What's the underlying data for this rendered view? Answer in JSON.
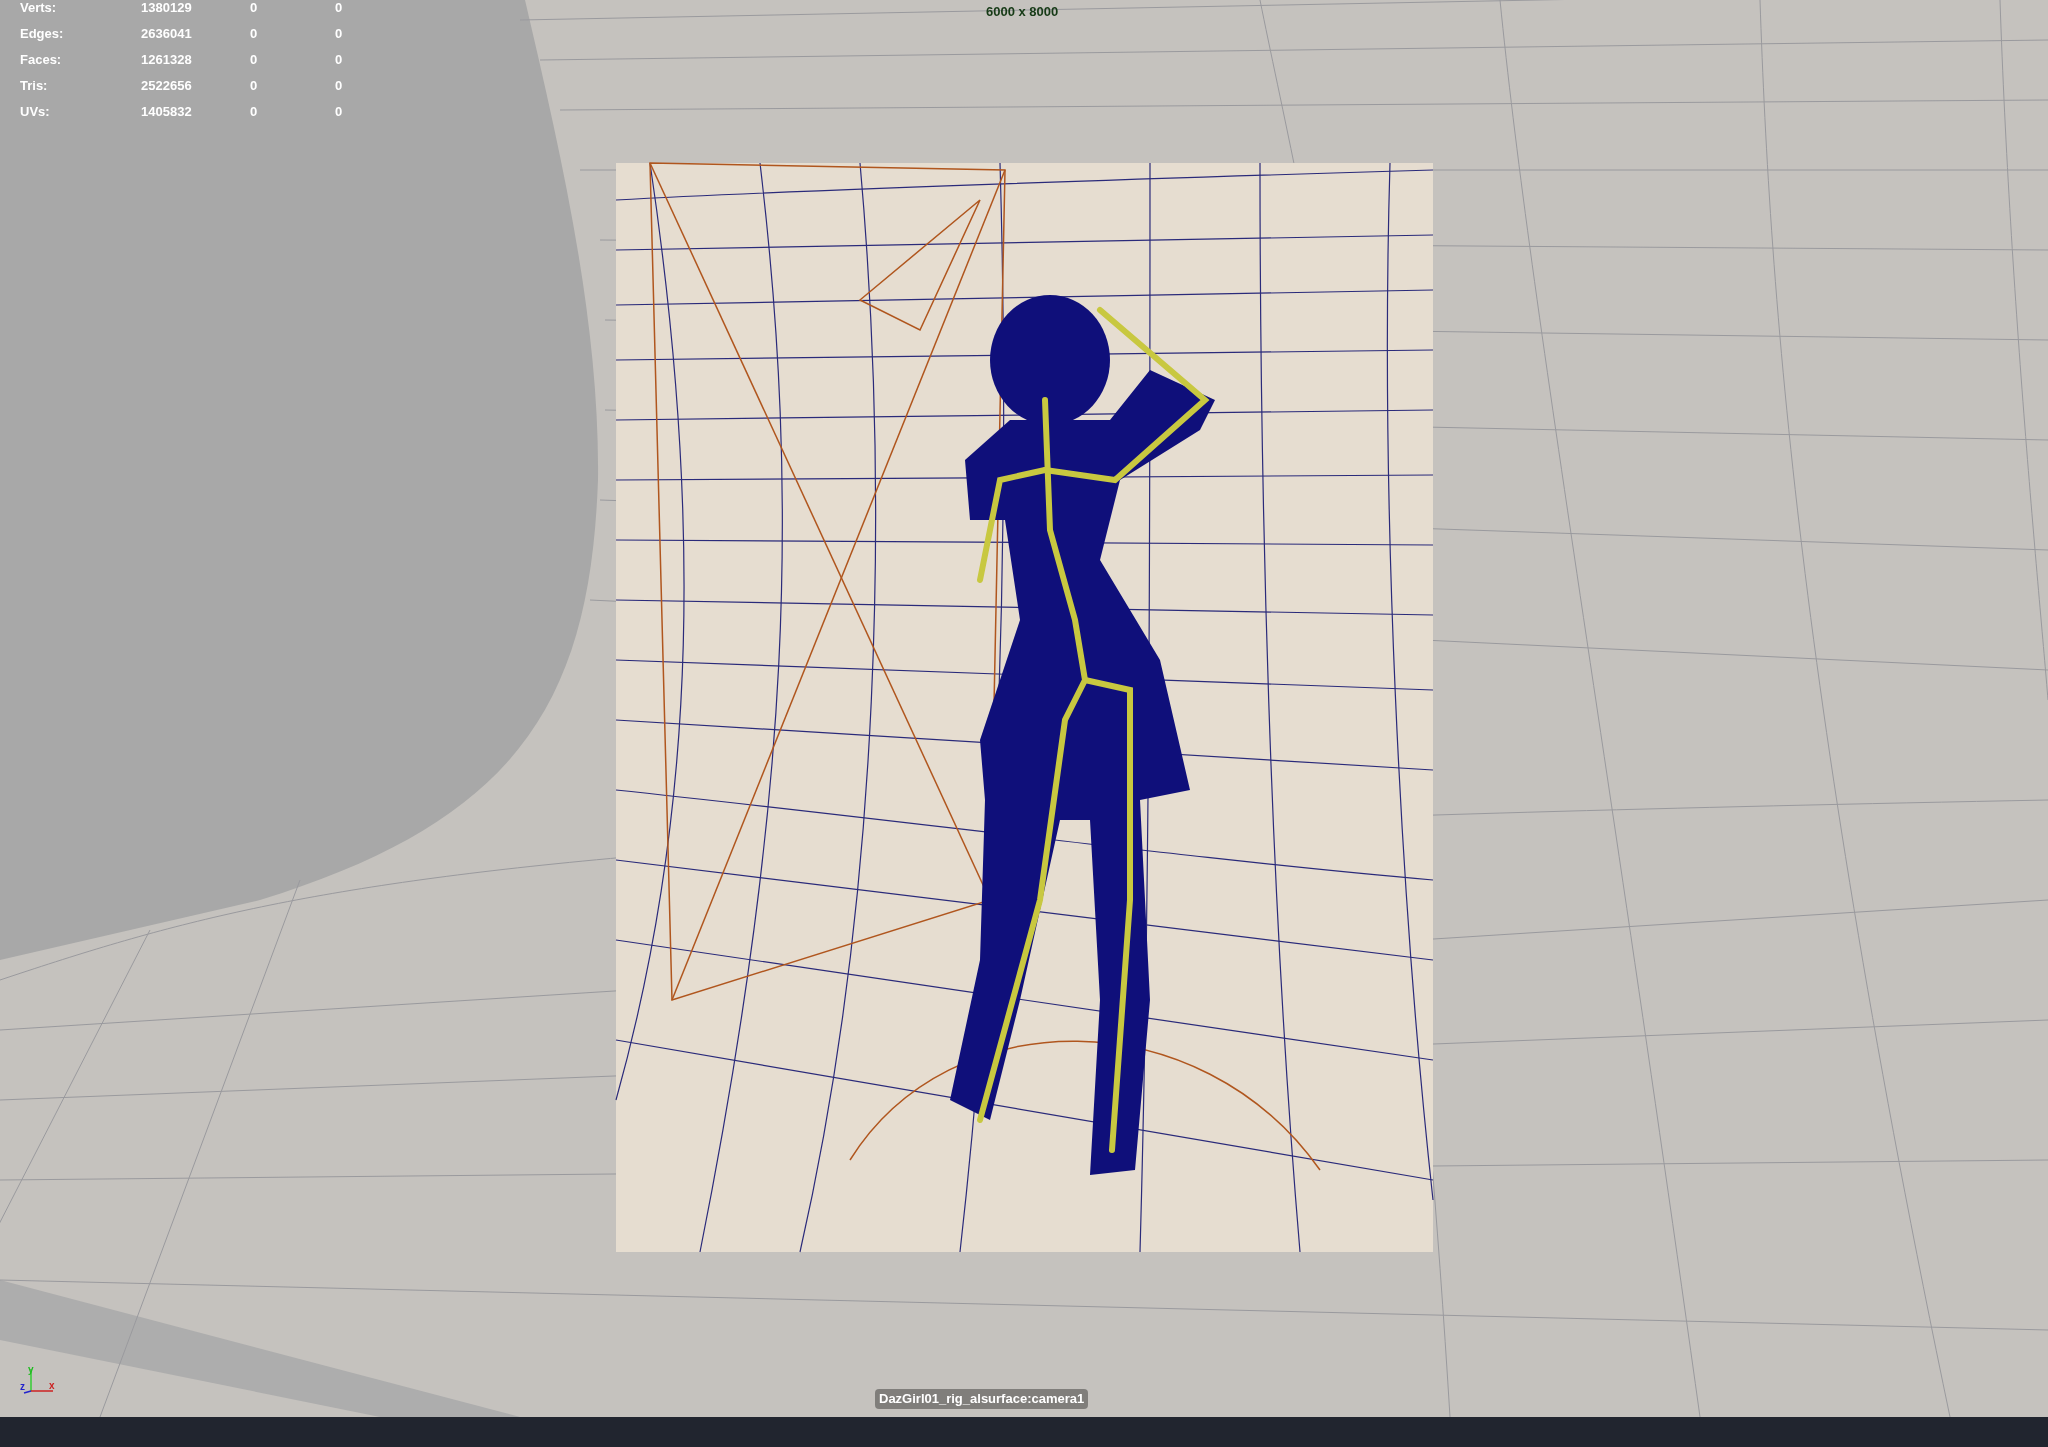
{
  "stats": [
    {
      "label": "Verts:",
      "values": [
        "1380129",
        "0",
        "0"
      ]
    },
    {
      "label": "Edges:",
      "values": [
        "2636041",
        "0",
        "0"
      ]
    },
    {
      "label": "Faces:",
      "values": [
        "1261328",
        "0",
        "0"
      ]
    },
    {
      "label": "Tris:",
      "values": [
        "2522656",
        "0",
        "0"
      ]
    },
    {
      "label": "UVs:",
      "values": [
        "1405832",
        "0",
        "0"
      ]
    }
  ],
  "resolution": "6000 x 8000",
  "camera_name": "DazGirl01_rig_alsurface:camera1",
  "axis_labels": {
    "y": "y",
    "z": "z",
    "x": "x"
  }
}
